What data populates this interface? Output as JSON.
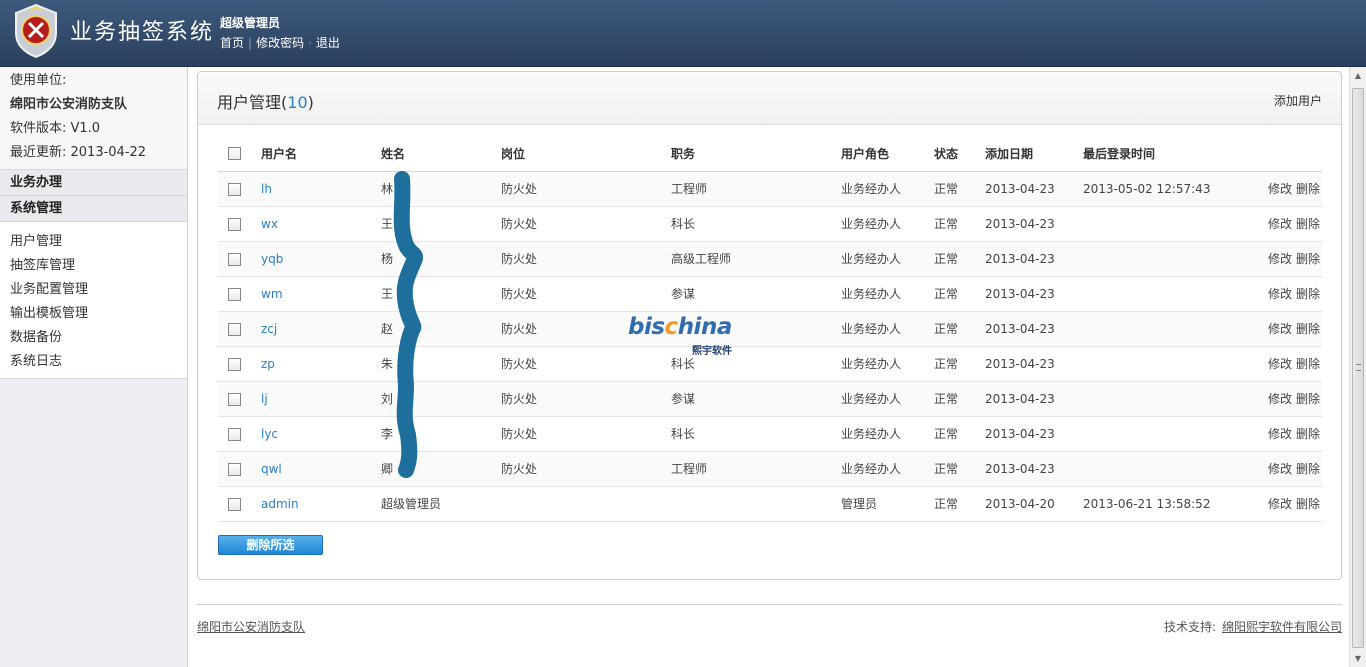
{
  "header": {
    "app_title": "业务抽签系统",
    "user_role": "超级管理员",
    "links": [
      "首页",
      "修改密码",
      "退出"
    ],
    "link_separators": [
      "|",
      "·"
    ]
  },
  "sidebar": {
    "info": {
      "unit_label": "使用单位:",
      "unit_name": "绵阳市公安消防支队",
      "version": "软件版本: V1.0",
      "updated": "最近更新: 2013-04-22"
    },
    "sections": [
      "业务办理",
      "系统管理"
    ],
    "menu": [
      "用户管理",
      "抽签库管理",
      "业务配置管理",
      "输出模板管理",
      "数据备份",
      "系统日志"
    ]
  },
  "main": {
    "title": "用户管理",
    "count": "10",
    "add_user": "添加用户",
    "columns": [
      "用户名",
      "姓名",
      "岗位",
      "职务",
      "用户角色",
      "状态",
      "添加日期",
      "最后登录时间"
    ],
    "rows": [
      {
        "username": "lh",
        "name": "林",
        "post": "防火处",
        "duty": "工程师",
        "role": "业务经办人",
        "status": "正常",
        "added": "2013-04-23",
        "last_login": "2013-05-02 12:57:43"
      },
      {
        "username": "wx",
        "name": "王",
        "post": "防火处",
        "duty": "科长",
        "role": "业务经办人",
        "status": "正常",
        "added": "2013-04-23",
        "last_login": ""
      },
      {
        "username": "yqb",
        "name": "杨",
        "post": "防火处",
        "duty": "高级工程师",
        "role": "业务经办人",
        "status": "正常",
        "added": "2013-04-23",
        "last_login": ""
      },
      {
        "username": "wm",
        "name": "王",
        "post": "防火处",
        "duty": "参谋",
        "role": "业务经办人",
        "status": "正常",
        "added": "2013-04-23",
        "last_login": ""
      },
      {
        "username": "zcj",
        "name": "赵",
        "post": "防火处",
        "duty": "",
        "role": "业务经办人",
        "status": "正常",
        "added": "2013-04-23",
        "last_login": ""
      },
      {
        "username": "zp",
        "name": "朱",
        "post": "防火处",
        "duty": "科长",
        "role": "业务经办人",
        "status": "正常",
        "added": "2013-04-23",
        "last_login": ""
      },
      {
        "username": "lj",
        "name": "刘",
        "post": "防火处",
        "duty": "参谋",
        "role": "业务经办人",
        "status": "正常",
        "added": "2013-04-23",
        "last_login": ""
      },
      {
        "username": "lyc",
        "name": "李",
        "post": "防火处",
        "duty": "科长",
        "role": "业务经办人",
        "status": "正常",
        "added": "2013-04-23",
        "last_login": ""
      },
      {
        "username": "qwl",
        "name": "卿",
        "post": "防火处",
        "duty": "工程师",
        "role": "业务经办人",
        "status": "正常",
        "added": "2013-04-23",
        "last_login": ""
      },
      {
        "username": "admin",
        "name": "超级管理员",
        "post": "",
        "duty": "",
        "role": "管理员",
        "status": "正常",
        "added": "2013-04-20",
        "last_login": "2013-06-21 13:58:52"
      }
    ],
    "row_actions": [
      "修改",
      "删除"
    ],
    "delete_selected": "删除所选"
  },
  "footer": {
    "left": "绵阳市公安消防支队",
    "support_label": "技术支持:",
    "support_company": "绵阳熙宇软件有限公司"
  },
  "watermark": {
    "brand_a": "bis",
    "brand_o": "c",
    "brand_b": "hina",
    "sub": "熙宇软件"
  },
  "colors": {
    "header_bg": "#2f4868",
    "link_blue": "#2a7fc9",
    "button_blue": "#1f86d6",
    "scribble": "#1e6f9c"
  }
}
